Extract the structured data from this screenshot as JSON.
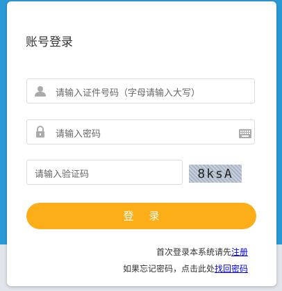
{
  "form": {
    "title": "账号登录",
    "id_placeholder": "请输入证件号码（字母请输入大写）",
    "password_placeholder": "请输入密码",
    "captcha_placeholder": "请输入验证码",
    "captcha_text": "8ksA",
    "login_label": "登录"
  },
  "links": {
    "register_text": "首次登录本系统请先",
    "register_link": "注册",
    "forgot_text": "如果忘记密码，点击此处",
    "forgot_link": "找回密码"
  },
  "colors": {
    "background": "#2a9ad6",
    "accent": "#fbae17",
    "link": "#0000ee"
  },
  "icons": [
    "user-icon",
    "lock-icon",
    "keyboard-icon"
  ]
}
